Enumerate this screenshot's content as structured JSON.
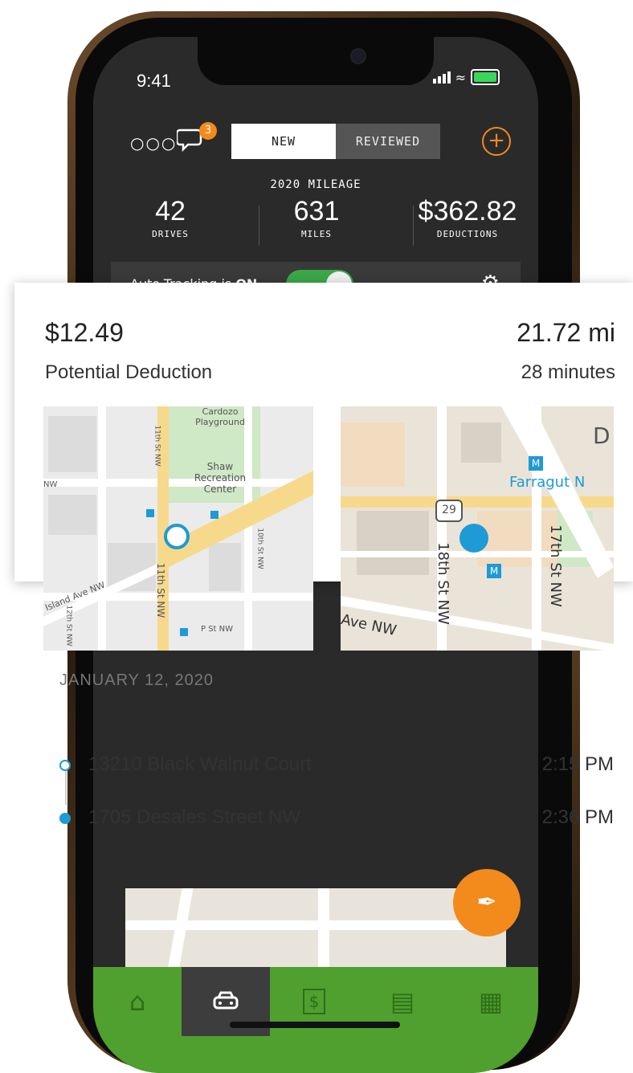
{
  "status_bar": {
    "time": "9:41"
  },
  "header": {
    "chat_badge": "3",
    "tabs": [
      {
        "label": "NEW",
        "active": true
      },
      {
        "label": "REVIEWED",
        "active": false
      }
    ],
    "add_icon": "plus-circle-icon"
  },
  "mileage": {
    "title": "2020 MILEAGE",
    "stats": [
      {
        "value": "42",
        "label": "DRIVES"
      },
      {
        "value": "631",
        "label": "MILES"
      },
      {
        "value": "$362.82",
        "label": "DEDUCTIONS"
      }
    ]
  },
  "auto_tracking": {
    "prefix": "Auto-Tracking is ",
    "state": "ON",
    "enabled": true
  },
  "drive_card": {
    "deduction_amount": "$12.49",
    "deduction_label": "Potential Deduction",
    "distance": "21.72 mi",
    "duration": "28 minutes",
    "date": "JANUARY 12, 2020",
    "start_map": {
      "labels": {
        "park": "Cardozo\nPlayground",
        "center": "Shaw\nRecreation\nCenter",
        "st11": "11th St NW",
        "st11b": "11th St NW",
        "st10": "10th St NW",
        "st12": "12th St NW",
        "ave": "Island Ave NW",
        "pst": "P St NW",
        "nw": "NW"
      }
    },
    "end_map": {
      "labels": {
        "farragut": "Farragut N",
        "st18": "18th St NW",
        "st17": "17th St NW",
        "ave": "Ave NW",
        "route": "29",
        "metro": "M",
        "d": "D"
      }
    },
    "stops": [
      {
        "address": "13210 Black Walnut Court",
        "time": "2:15 PM"
      },
      {
        "address": "1705 Desales Street NW",
        "time": "2:36 PM"
      }
    ]
  },
  "tab_bar": {
    "items": [
      {
        "icon": "home-icon",
        "active": false
      },
      {
        "icon": "car-icon",
        "active": true
      },
      {
        "icon": "receipt-icon",
        "active": false
      },
      {
        "icon": "money-icon",
        "active": false
      },
      {
        "icon": "store-icon",
        "active": false
      }
    ]
  },
  "colors": {
    "accent": "#f28a1c",
    "green": "#4fa02e",
    "blue": "#1e9ad6",
    "dark": "#2a2a2a"
  }
}
